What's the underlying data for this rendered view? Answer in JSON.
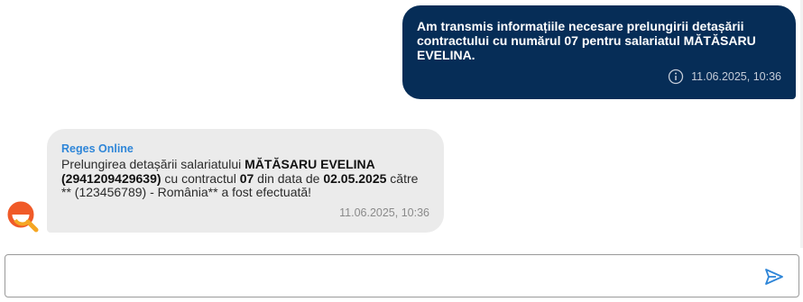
{
  "outgoing": {
    "text": "Am transmis informațiile necesare prelungirii detașării contractului cu numărul 07 pentru salariatul MĂTĂSARU EVELINA.",
    "timestamp": "11.06.2025, 10:36",
    "icon": "info-icon"
  },
  "incoming": {
    "sender": "Reges Online",
    "text_parts": {
      "p1": "Prelungirea detașării salariatului ",
      "name": "MĂTĂSARU  EVELINA",
      "p2": " ",
      "cnp": "(2941209429639)",
      "p3": " cu contractul ",
      "contract": "07",
      "p4": " din data de ",
      "date": "02.05.2025",
      "p5": " către ** (123456789) - România** a fost efectuată!"
    },
    "timestamp": "11.06.2025, 10:36",
    "avatar_icon": "reges-logo-icon"
  },
  "composer": {
    "placeholder": "",
    "value": "",
    "send_icon": "send-icon"
  },
  "colors": {
    "outgoing_bg": "#062d57",
    "incoming_bg": "#ebebeb",
    "sender": "#2f86d8",
    "accent": "#2f86d8",
    "avatar_orange": "#f05a28",
    "avatar_yellow": "#f5a623"
  }
}
